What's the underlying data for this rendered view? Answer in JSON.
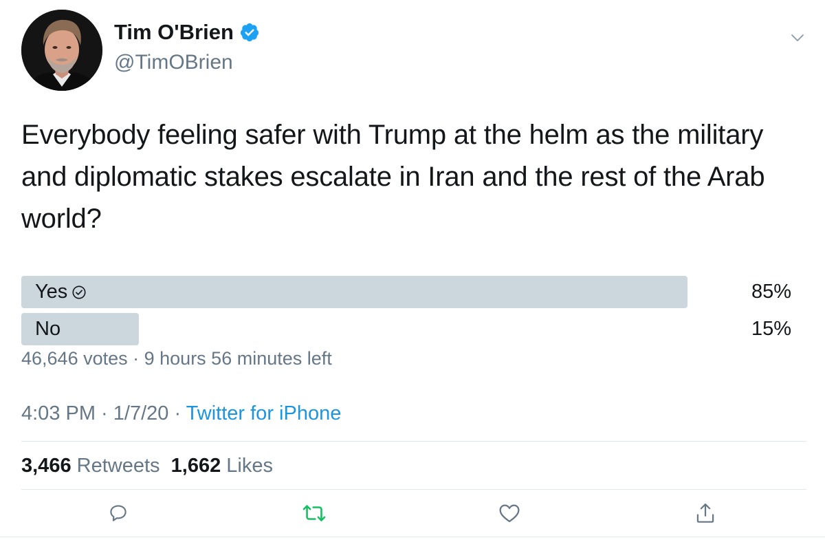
{
  "author": {
    "display_name": "Tim O'Brien",
    "handle": "@TimOBrien",
    "verified_icon": "verified-badge-icon",
    "avatar_icon": "profile-photo"
  },
  "tweet": {
    "text": "Everybody feeling safer with Trump at the helm as the military and diplomatic stakes escalate in Iran and the rest of the Arab world?"
  },
  "poll": {
    "options": [
      {
        "label": "Yes",
        "percent_text": "85%",
        "percent": 85,
        "selected": true
      },
      {
        "label": "No",
        "percent_text": "15%",
        "percent": 15,
        "selected": false
      }
    ],
    "votes": "46,646 votes",
    "separator": " · ",
    "time_left": "9 hours 56 minutes left"
  },
  "meta": {
    "time": "4:03 PM",
    "date": "1/7/20",
    "separator": " · ",
    "source": "Twitter for iPhone"
  },
  "stats": {
    "retweets_count": "3,466",
    "retweets_label": "Retweets",
    "likes_count": "1,662",
    "likes_label": "Likes"
  },
  "actions": {
    "reply_icon": "reply-icon",
    "retweet_icon": "retweet-icon",
    "like_icon": "heart-icon",
    "share_icon": "share-icon"
  },
  "colors": {
    "accent_blue": "#1b95e0",
    "retweet_green": "#17bf63",
    "poll_bar": "#ccd6dd",
    "secondary_text": "#657786",
    "primary_text": "#14171a"
  }
}
